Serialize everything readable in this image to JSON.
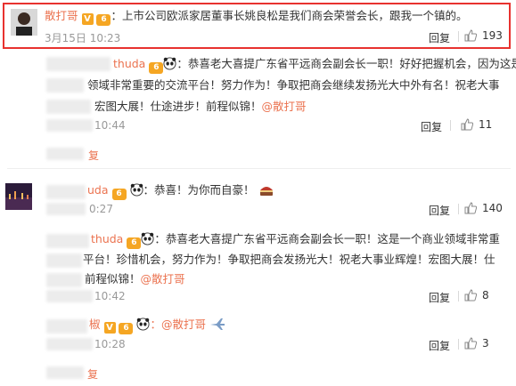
{
  "c1": {
    "user": "散打哥",
    "text": "：上市公司欧派家居董事长姚良松是我们商会荣誉会长，跟我一个镇的。",
    "time": "3月15日 10:23",
    "reply": "回复",
    "likes": "193"
  },
  "c2": {
    "user_partial": "thuda",
    "text_line1": "：恭喜老大喜提广东省平远商会副会长一职！好好把握机会，因为这是",
    "text_line2": "领域非常重要的交流平台！努力作为！争取把商会继续发扬光大中外有名！祝老大事",
    "text_line3": "宏图大展！仕途进步！前程似锦！",
    "mention": "@散打哥",
    "time": "10:44",
    "reply": "回复",
    "likes": "11",
    "reply_below": "复"
  },
  "c3": {
    "user_partial": "uda",
    "text": "：恭喜！为你而自豪！",
    "time": "0:27",
    "reply": "回复",
    "likes": "140"
  },
  "c4": {
    "user_partial": "thuda",
    "text_line1": "：恭喜老大喜提广东省平远商会副会长一职！这是一个商业领域非常重",
    "text_line2": "平台！珍惜机会，努力作为！争取把商会发扬光大！祝老大事业辉煌！宏图大展！仕",
    "text_line3": "前程似锦！",
    "mention": "@散打哥",
    "time": "10:42",
    "reply": "回复",
    "likes": "8"
  },
  "c5": {
    "user_partial": "椒",
    "mention": "：@散打哥",
    "time": "10:28",
    "reply": "回复",
    "likes": "3"
  },
  "c6": {
    "reply_partial": "复"
  },
  "icons": {
    "like": "thumbs-up-icon",
    "verified": "verified-v-icon",
    "member": "member-badge-icon",
    "panda": "panda-emoji-icon",
    "plane": "plane-emoji-icon",
    "cake": "cake-emoji-icon"
  },
  "colors": {
    "username": "#eb7350",
    "highlight_border": "#e8322f"
  }
}
